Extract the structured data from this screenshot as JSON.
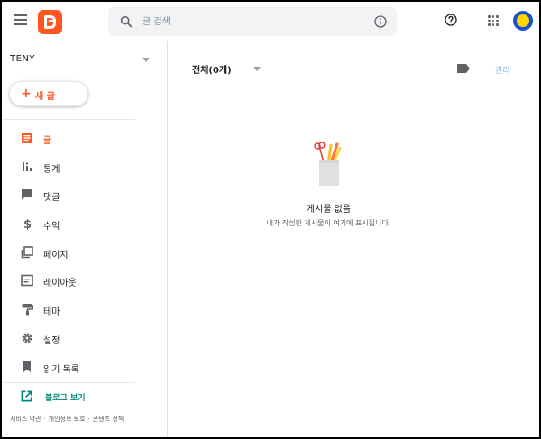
{
  "topbar": {
    "search_placeholder": "글 검색"
  },
  "sidebar": {
    "blog_name": "TENY",
    "new_post_label": "새 글",
    "items": [
      {
        "label": "글",
        "icon": "posts-icon",
        "active": true
      },
      {
        "label": "통계",
        "icon": "stats-icon",
        "active": false
      },
      {
        "label": "댓글",
        "icon": "comments-icon",
        "active": false
      },
      {
        "label": "수익",
        "icon": "earnings-icon",
        "active": false
      },
      {
        "label": "페이지",
        "icon": "pages-icon",
        "active": false
      },
      {
        "label": "레이아웃",
        "icon": "layout-icon",
        "active": false
      },
      {
        "label": "테마",
        "icon": "theme-icon",
        "active": false
      },
      {
        "label": "설정",
        "icon": "settings-icon",
        "active": false
      },
      {
        "label": "읽기 목록",
        "icon": "reading-list-icon",
        "active": false
      }
    ],
    "view_blog_label": "블로그 보기",
    "footer_links": [
      "서비스 약관",
      "개인정보 보호",
      "콘텐츠 정책"
    ]
  },
  "main": {
    "filter_label": "전체(0개)",
    "manage_label": "관리",
    "empty_title": "게시물 없음",
    "empty_subtitle": "내가 작성한 게시물이 여기에 표시됩니다."
  },
  "colors": {
    "accent": "#ff5722",
    "link_teal": "#00897b",
    "icon_gray": "#5f6368"
  }
}
